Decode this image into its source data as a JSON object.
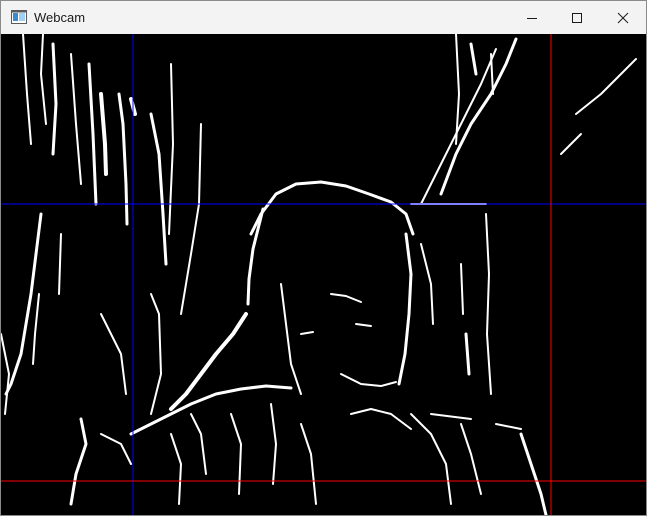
{
  "window": {
    "title": "Webcam"
  },
  "controls": {
    "minimize_icon": "minimize-icon",
    "maximize_icon": "maximize-icon",
    "close_icon": "close-icon"
  },
  "feed": {
    "background": "#000000",
    "edge_color": "#ffffff",
    "crosshair_blue": "#0000ff",
    "crosshair_red": "#ff0000"
  }
}
